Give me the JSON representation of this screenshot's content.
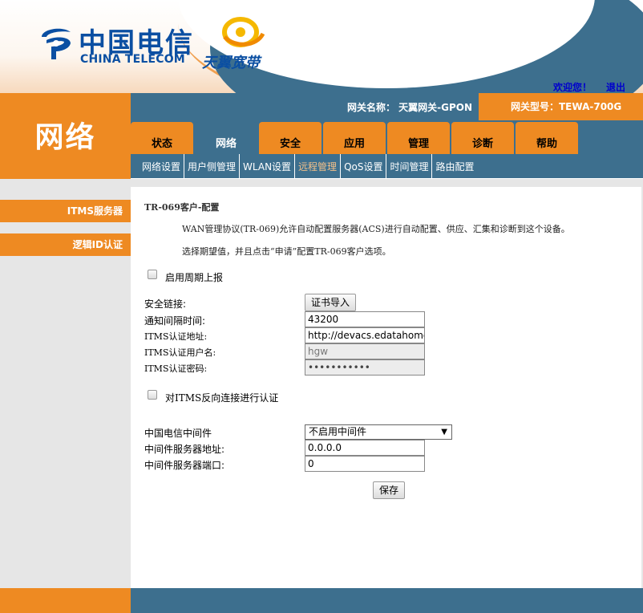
{
  "header": {
    "brand_cn": "中国电信",
    "brand_en": "CHINA TELECOM",
    "sub_brand": "天翼宽带",
    "welcome": "欢迎您！",
    "logout": "退出"
  },
  "info": {
    "gateway_name": "网关名称： 天翼网关-GPON",
    "gateway_model": "网关型号：TEWA-700G"
  },
  "page_title": "网络",
  "tabs": [
    {
      "label": "状态"
    },
    {
      "label": "网络"
    },
    {
      "label": "安全"
    },
    {
      "label": "应用"
    },
    {
      "label": "管理"
    },
    {
      "label": "诊断"
    },
    {
      "label": "帮助"
    }
  ],
  "subnav": [
    {
      "label": "网络设置"
    },
    {
      "label": "用户侧管理"
    },
    {
      "label": "WLAN设置"
    },
    {
      "label": "远程管理"
    },
    {
      "label": "QoS设置"
    },
    {
      "label": "时间管理"
    },
    {
      "label": "路由配置"
    }
  ],
  "sidebar": [
    {
      "label": "ITMS服务器"
    },
    {
      "label": "逻辑ID认证"
    }
  ],
  "form": {
    "section_title": "TR-069客户-配置",
    "desc1": "WAN管理协议(TR-069)允许自动配置服务器(ACS)进行自动配置、供应、汇集和诊断到这个设备。",
    "desc2": "选择期望值，并且点击“申请”配置TR-069客户选项。",
    "periodic_label": "启用周期上报",
    "secure_link_label": "安全链接:",
    "cert_import_button": "证书导入",
    "inform_interval_label": "通知间隔时间:",
    "inform_interval_value": "43200",
    "itms_url_label": "ITMS认证地址:",
    "itms_url_value": "http://devacs.edatahome.cc",
    "itms_user_label": "ITMS认证用户名:",
    "itms_user_value": "hgw",
    "itms_pass_label": "ITMS认证密码:",
    "itms_pass_value": "•••••••••••",
    "reverse_auth_label": "对ITMS反向连接进行认证",
    "middleware_label": "中国电信中间件",
    "middleware_value": "不启用中间件",
    "mw_addr_label": "中间件服务器地址:",
    "mw_addr_value": "0.0.0.0",
    "mw_port_label": "中间件服务器端口:",
    "mw_port_value": "0",
    "save_button": "保存"
  },
  "colors": {
    "orange": "#ee8a22",
    "blue": "#3d6f8e",
    "brand_blue": "#0b4fa2"
  }
}
